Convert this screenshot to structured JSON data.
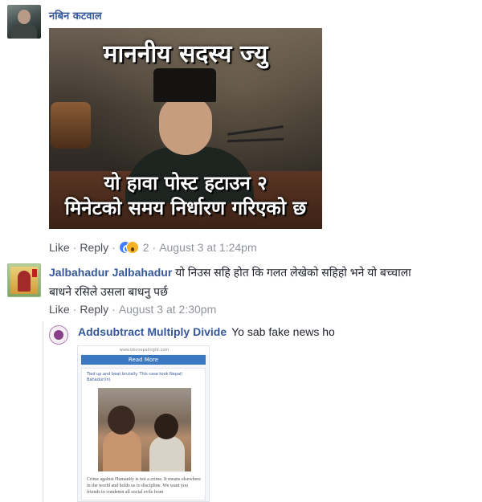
{
  "comments": [
    {
      "author": "नबिन कटवाल",
      "image": {
        "caption_top": "माननीय सदस्य ज्यु",
        "caption_bottom_line1": "यो हावा पोस्ट हटाउन २",
        "caption_bottom_line2": "मिनेटको समय निर्धारण गरिएको छ"
      },
      "actions": {
        "like": "Like",
        "reply": "Reply"
      },
      "reaction_count": "2",
      "timestamp": "August 3 at 1:24pm"
    },
    {
      "author": "Jalbahadur Jalbahadur",
      "text_line1": "यो निउस सहि होत कि गलत लेखेको सहिहो भने यो बच्चाला",
      "text_line2": "बाधने रसिले उसला बाधनु पर्छ",
      "actions": {
        "like": "Like",
        "reply": "Reply"
      },
      "timestamp": "August 3 at 2:30pm"
    }
  ],
  "reply": {
    "author": "Addsubtract Multiply Divide",
    "text": "Yo sab fake news ho",
    "attachment": {
      "url_text": "www.bbcnepalnight.com",
      "header_bar": "Read More",
      "post_header": "Tied up and beat brutally. This case took Nepali Bahadur(in)",
      "body_text": "Crime against Humanity is not a crime. It means elsewhere in the world and holds us to discipline. We want you friends to condemn all social evils from"
    }
  },
  "colors": {
    "link_blue": "#365899",
    "meta_gray": "#90949c",
    "text": "#1d2129"
  },
  "icons": [
    "like-reaction-icon",
    "wow-reaction-icon"
  ]
}
